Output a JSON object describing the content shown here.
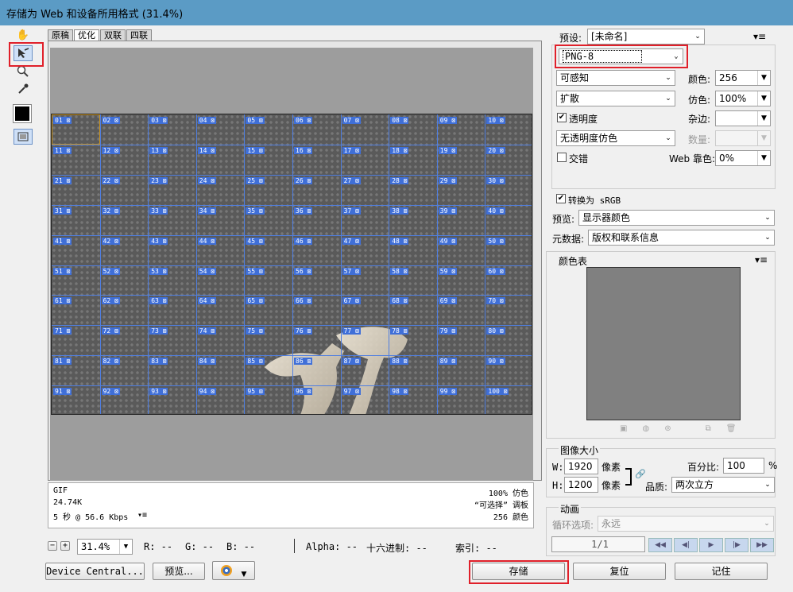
{
  "window": {
    "title": "存储为 Web 和设备所用格式 (31.4%)"
  },
  "tabs": [
    "原稿",
    "优化",
    "双联",
    "四联"
  ],
  "tools": [
    "hand-icon",
    "slice-select-icon",
    "zoom-icon",
    "eyedropper-icon",
    "color-swatch",
    "toggle-slice-visibility-icon"
  ],
  "slices": [
    "01",
    "02",
    "03",
    "04",
    "05",
    "06",
    "07",
    "08",
    "09",
    "10",
    "11",
    "12",
    "13",
    "14",
    "15",
    "16",
    "17",
    "18",
    "19",
    "20",
    "21",
    "22",
    "23",
    "24",
    "25",
    "26",
    "27",
    "28",
    "29",
    "30",
    "31",
    "32",
    "33",
    "34",
    "35",
    "36",
    "37",
    "38",
    "39",
    "40",
    "41",
    "42",
    "43",
    "44",
    "45",
    "46",
    "47",
    "48",
    "49",
    "50",
    "51",
    "52",
    "53",
    "54",
    "55",
    "56",
    "57",
    "58",
    "59",
    "60",
    "61",
    "62",
    "63",
    "64",
    "65",
    "66",
    "67",
    "68",
    "69",
    "70",
    "71",
    "72",
    "73",
    "74",
    "75",
    "76",
    "77",
    "78",
    "79",
    "80",
    "81",
    "82",
    "83",
    "84",
    "85",
    "86",
    "87",
    "88",
    "89",
    "90",
    "91",
    "92",
    "93",
    "94",
    "95",
    "96",
    "97",
    "98",
    "99",
    "100"
  ],
  "info": {
    "format": "GIF",
    "size": "24.74K",
    "time": "5 秒 @ 56.6 Kbps",
    "quality": "100% 仿色",
    "palette": "“可选择” 调板",
    "colors": "256 颜色"
  },
  "status": {
    "zoom": "31.4%",
    "r": "R: --",
    "g": "G: --",
    "b": "B: --",
    "alpha": "Alpha: --",
    "hex": "十六进制: --",
    "index": "索引: --"
  },
  "buttons": {
    "device_central": "Device Central...",
    "preview": "预览...",
    "save": "存储",
    "reset": "复位",
    "remember": "记住"
  },
  "settings": {
    "preset_label": "预设:",
    "preset_value": "[未命名]",
    "format": "PNG-8",
    "reduction": "可感知",
    "colors_label": "颜色:",
    "colors": "256",
    "dither_algo": "扩散",
    "dither_label": "仿色:",
    "dither": "100%",
    "transparency_label": "透明度",
    "transparency_checked": true,
    "matte_label": "杂边:",
    "matte": "",
    "trans_dither": "无透明度仿色",
    "amount_label": "数量:",
    "interlaced_label": "交错",
    "interlaced_checked": false,
    "web_snap_label": "Web 靠色:",
    "web_snap": "0%",
    "convert_srgb_label": "转换为 sRGB",
    "convert_srgb_checked": true,
    "preview_label": "预览:",
    "preview_value": "显示器颜色",
    "metadata_label": "元数据:",
    "metadata_value": "版权和联系信息"
  },
  "color_table": {
    "title": "颜色表",
    "swatch_color": "#808080"
  },
  "image_size": {
    "title": "图像大小",
    "w_label": "W:",
    "w": "1920",
    "h_label": "H:",
    "h": "1200",
    "unit": "像素",
    "percent_label": "百分比:",
    "percent": "100",
    "percent_unit": "%",
    "quality_label": "品质:",
    "quality": "两次立方"
  },
  "animation": {
    "title": "动画",
    "loop_label": "循环选项:",
    "loop": "永远",
    "frame": "1/1"
  }
}
